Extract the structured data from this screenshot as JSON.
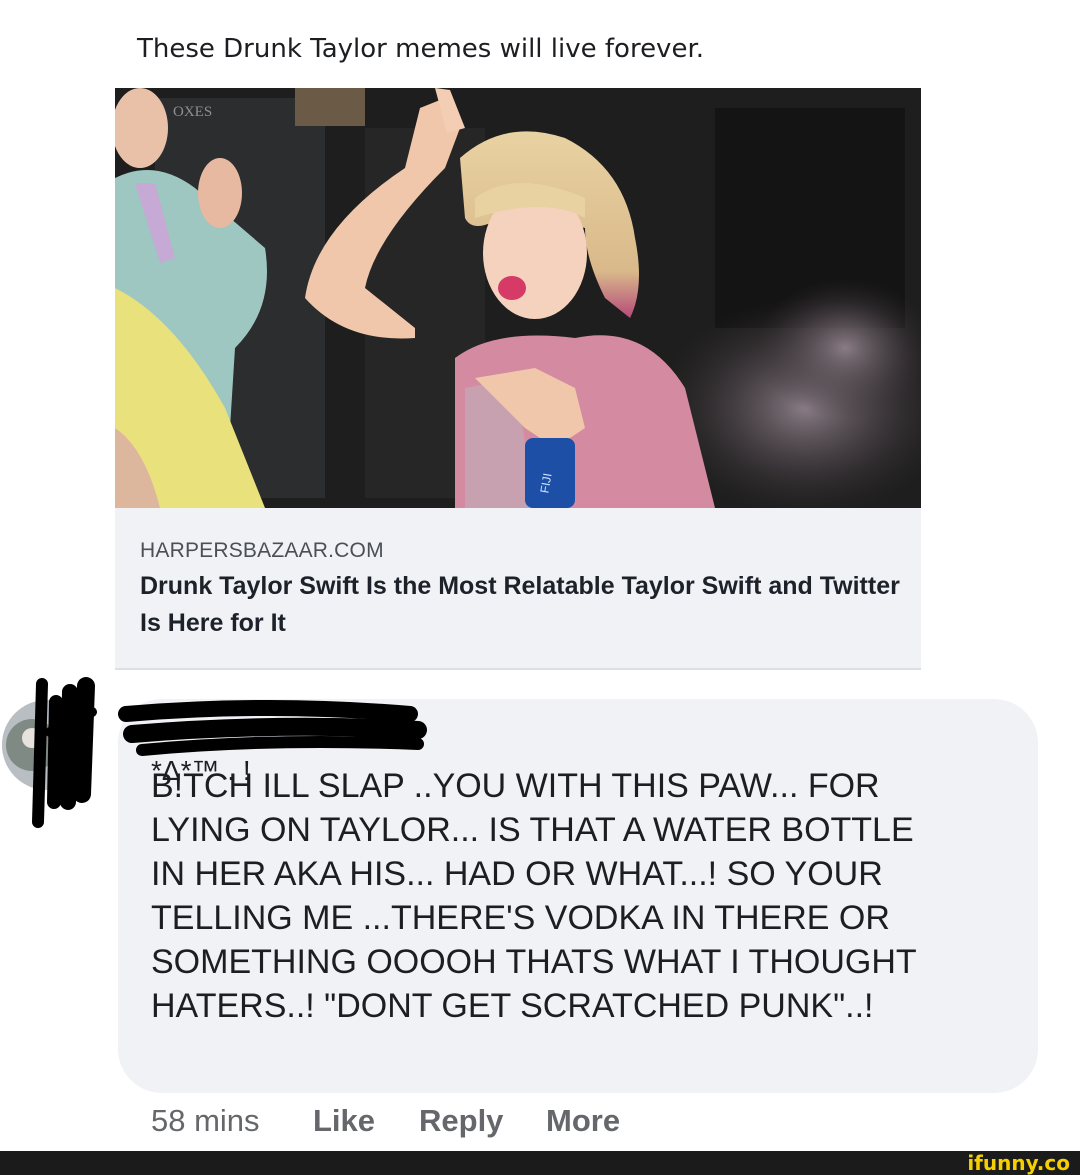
{
  "post": {
    "text": "These Drunk Taylor memes will live forever."
  },
  "link_preview": {
    "image_alt": "Taylor Swift dancing and holding a water bottle at a party",
    "image_sign_text": "OXES",
    "bottle_label": "FIJI",
    "domain": "HARPERSBAZAAR.COM",
    "title": "Drunk Taylor Swift Is the Most Relatable Taylor Swift and Twitter Is Here for It"
  },
  "comment": {
    "emoticon": "*Δ*™ . !",
    "body": "B!TCH ILL SLAP ..YOU WITH THIS PAW... FOR\nLYING ON TAYLOR... IS THAT A WATER BOTTLE\nIN HER AKA HIS... HAD OR WHAT...! SO YOUR\nTELLING ME ...THERE'S VODKA IN THERE OR\nSOMETHING OOOOH THATS WHAT I THOUGHT\nHATERS..! \"DONT GET SCRATCHED PUNK\"..!",
    "time": "58 mins",
    "like_label": "Like",
    "reply_label": "Reply",
    "more_label": "More"
  },
  "watermark": "ifunny.co",
  "colors": {
    "bubble": "#f0f2f5",
    "action_text": "#65676b",
    "watermark": "#f6cf00"
  }
}
